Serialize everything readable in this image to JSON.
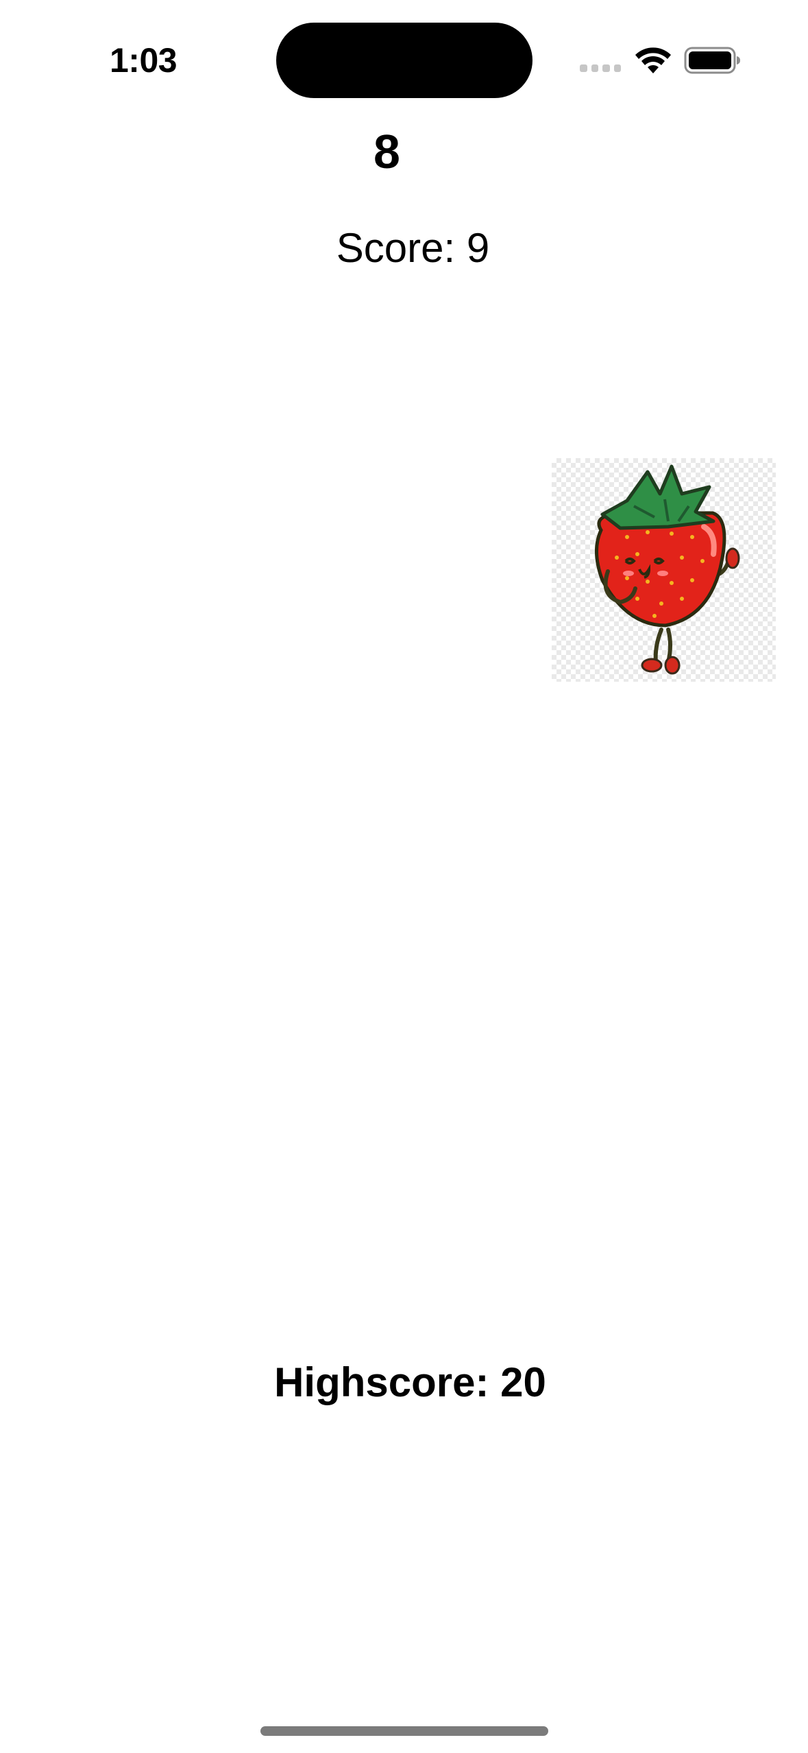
{
  "status_bar": {
    "time": "1:03",
    "icons": [
      "cellular-signal-icon",
      "wifi-icon",
      "battery-icon"
    ]
  },
  "game": {
    "countdown": "8",
    "score": "Score: 9",
    "highscore": "Highscore: 20",
    "target_icon": "strawberry-character-icon"
  },
  "colors": {
    "background": "#ffffff",
    "text": "#000000",
    "strawberry_red": "#e2231a",
    "leaf_green": "#2f8f46",
    "home_indicator": "#7b7b7b"
  }
}
